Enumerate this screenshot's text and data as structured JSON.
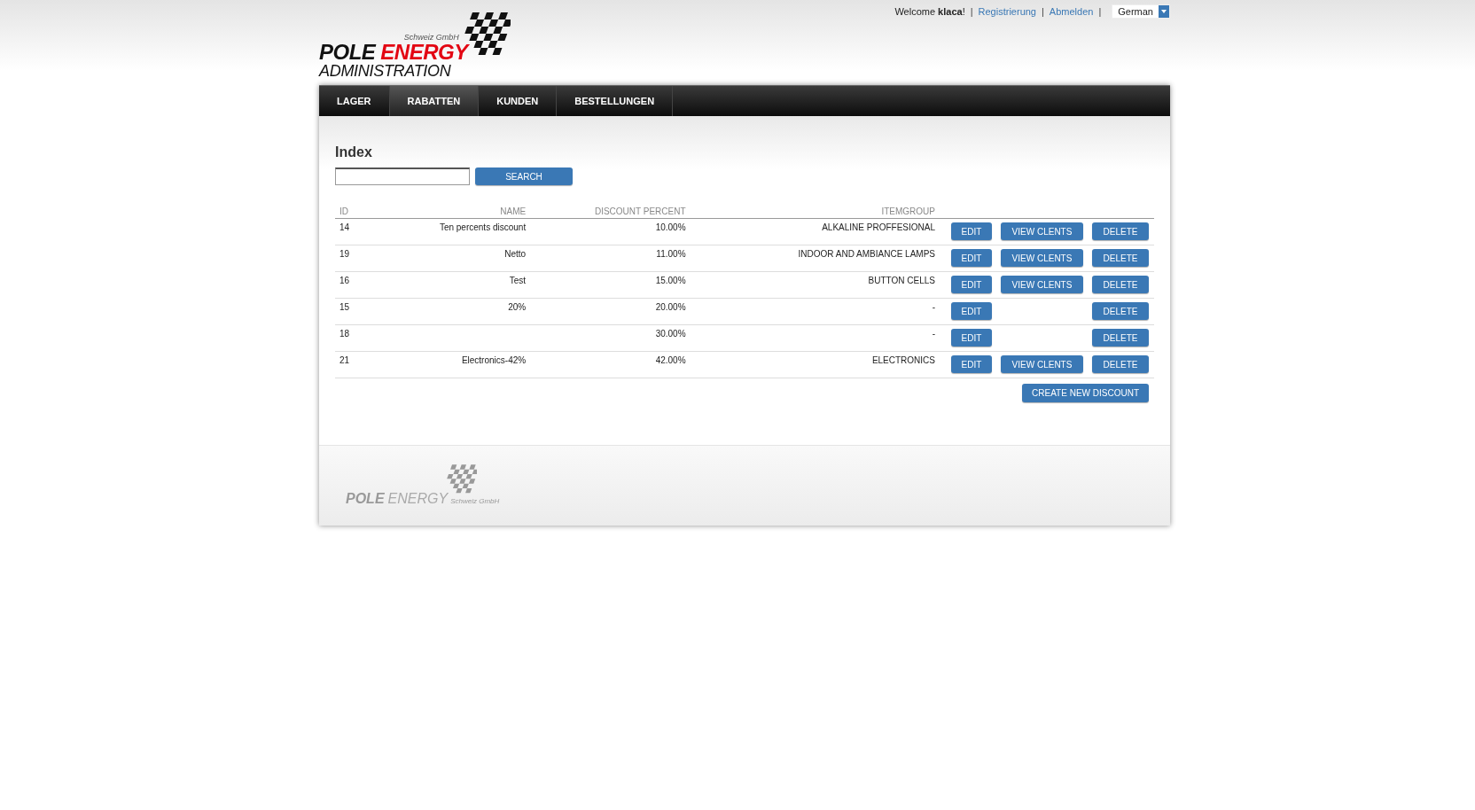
{
  "top_bar": {
    "welcome": "Welcome **klaca**!",
    "links": [
      "Registrierung",
      "Abmelden"
    ],
    "separators": [
      "|",
      "|",
      "|"
    ],
    "language": "German"
  },
  "logo": {
    "company": "Schweiz GmbH",
    "word_1": "POLE",
    "word_2": "ENERGY",
    "subtitle": "ADMINISTRATION"
  },
  "nav": [
    {
      "label": "LAGER",
      "selected": false
    },
    {
      "label": "RABATTEN",
      "selected": true
    },
    {
      "label": "KUNDEN",
      "selected": false
    },
    {
      "label": "BESTELLUNGEN",
      "selected": false
    }
  ],
  "page_title": "Index",
  "search": {
    "button": "SEARCH"
  },
  "table": {
    "columns": [
      "ID",
      "NAME",
      "DISCOUNT PERCENT",
      "ITEMGROUP"
    ],
    "rows": [
      {
        "id": "14",
        "name": "Ten percents discount",
        "percent": "10.00%",
        "itemgroup": "ALKALINE PROFFESIONAL",
        "actions": [
          {
            "kind": "edit",
            "label": "EDIT"
          },
          {
            "kind": "view",
            "label": "VIEW CLENTS"
          },
          {
            "kind": "delete",
            "label": "DELETE"
          }
        ]
      },
      {
        "id": "19",
        "name": "Netto",
        "percent": "11.00%",
        "itemgroup": "INDOOR AND AMBIANCE LAMPS",
        "actions": [
          {
            "kind": "edit",
            "label": "EDIT"
          },
          {
            "kind": "view",
            "label": "VIEW CLENTS"
          },
          {
            "kind": "delete",
            "label": "DELETE"
          }
        ]
      },
      {
        "id": "16",
        "name": "Test",
        "percent": "15.00%",
        "itemgroup": "BUTTON CELLS",
        "actions": [
          {
            "kind": "edit",
            "label": "EDIT"
          },
          {
            "kind": "view",
            "label": "VIEW CLENTS"
          },
          {
            "kind": "delete",
            "label": "DELETE"
          }
        ]
      },
      {
        "id": "15",
        "name": "20%",
        "percent": "20.00%",
        "itemgroup": "-",
        "actions": [
          {
            "kind": "edit",
            "label": "EDIT"
          },
          {
            "kind": "delete",
            "label": "DELETE"
          }
        ]
      },
      {
        "id": "18",
        "percent": "30.00%",
        "itemgroup": "-",
        "actions": [
          {
            "kind": "edit",
            "label": "EDIT"
          },
          {
            "kind": "delete",
            "label": "DELETE"
          }
        ]
      },
      {
        "id": "21",
        "name": "Electronics-42%",
        "percent": "42.00%",
        "itemgroup": "ELECTRONICS",
        "actions": [
          {
            "kind": "edit",
            "label": "EDIT"
          },
          {
            "kind": "view",
            "label": "VIEW CLENTS"
          },
          {
            "kind": "delete",
            "label": "DELETE"
          }
        ]
      }
    ]
  },
  "create_button": "CREATE NEW DISCOUNT",
  "footer_logo": {
    "word_1": "POLE",
    "word_2": "ENERGY",
    "company": "Schweiz GmbH"
  }
}
